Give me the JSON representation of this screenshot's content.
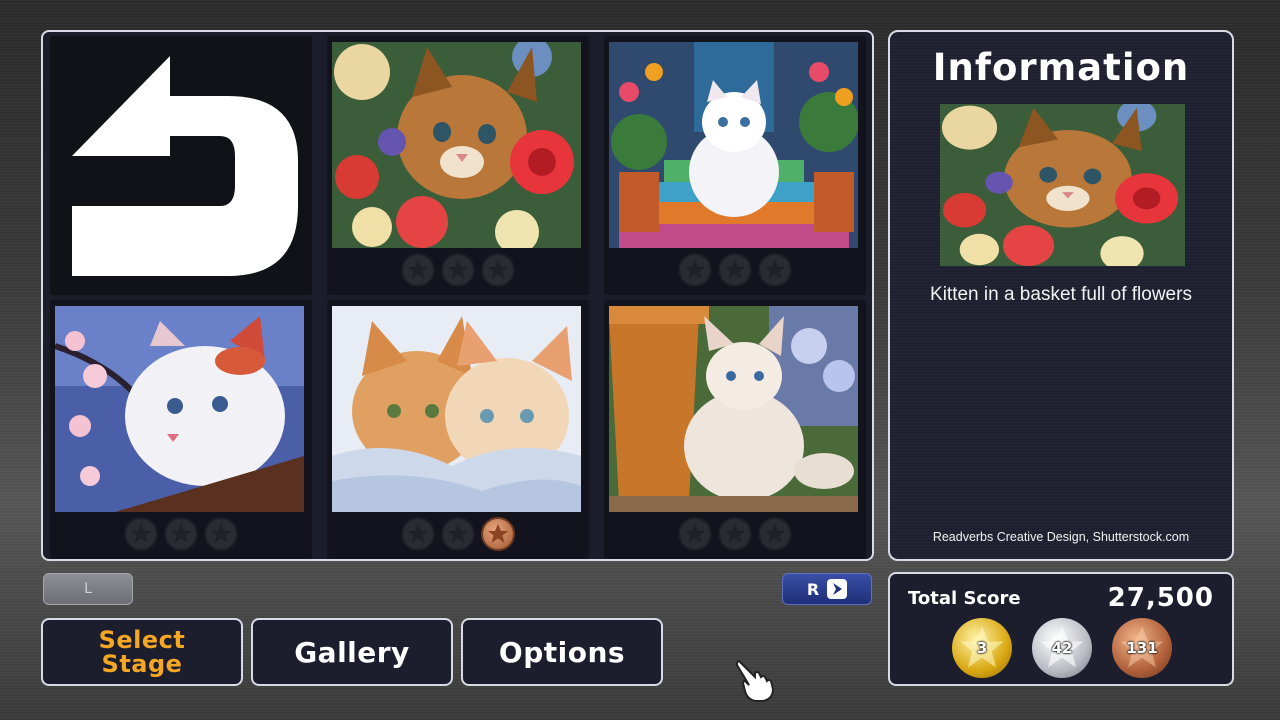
{
  "info": {
    "title": "Information",
    "description": "Kitten in a basket full of flowers",
    "credit": "Readverbs Creative Design, Shutterstock.com"
  },
  "stages": [
    {
      "name": "back",
      "icon": "back-arrow-icon"
    },
    {
      "name": "stage-1",
      "stars": [
        "empty",
        "empty",
        "empty"
      ]
    },
    {
      "name": "stage-2",
      "stars": [
        "empty",
        "empty",
        "empty"
      ]
    },
    {
      "name": "stage-3",
      "stars": [
        "empty",
        "empty",
        "empty"
      ]
    },
    {
      "name": "stage-4",
      "stars": [
        "empty",
        "empty",
        "bronze"
      ]
    },
    {
      "name": "stage-5",
      "stars": [
        "empty",
        "empty",
        "empty"
      ]
    }
  ],
  "shoulder": {
    "left": "L",
    "right": "R"
  },
  "menu": {
    "select_stage": "Select Stage",
    "gallery": "Gallery",
    "options": "Options"
  },
  "score": {
    "label": "Total Score",
    "value": "27,500",
    "gold": "3",
    "silver": "42",
    "bronze": "131"
  },
  "colors": {
    "accent": "#f5a623",
    "panel_border": "#d8dbe6",
    "panel_bg": "#1c1e2e",
    "r_button": "#2a3c90"
  }
}
